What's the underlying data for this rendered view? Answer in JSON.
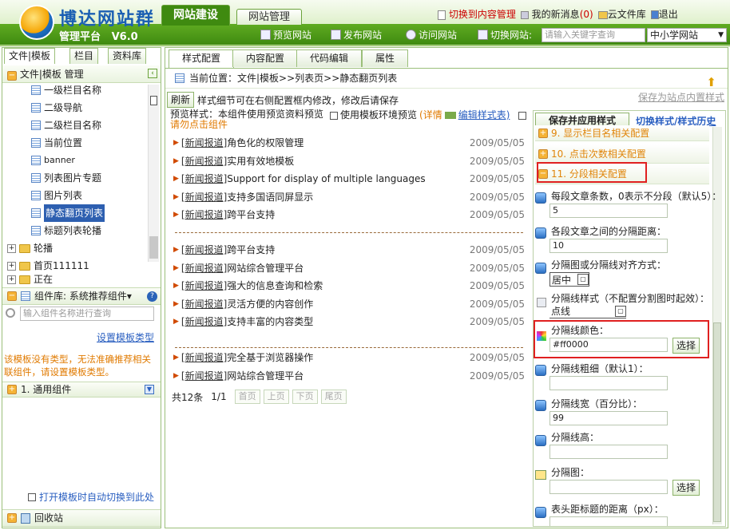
{
  "app": {
    "brand": "博达网站群",
    "subtitle": "管理平台",
    "version": "V6.0",
    "top_tabs": [
      "网站建设",
      "网站管理"
    ],
    "top_links": {
      "switch_content": "切换到内容管理",
      "messages": "我的新消息",
      "message_count": "(0)",
      "cloud_files": "云文件库",
      "logout": "退出"
    },
    "toolbar": {
      "preview_site": "预览网站",
      "publish_site": "发布网站",
      "visit_site": "访问网站",
      "switch_site": "切换网站:",
      "search_placeholder": "请输入关键字查询",
      "site_select": "中小学网站"
    }
  },
  "left": {
    "tabs": [
      "文件|模板",
      "栏目",
      "资料库"
    ],
    "tree_title": "文件|模板 管理",
    "tree_items": [
      "一级栏目名称",
      "二级导航",
      "二级栏目名称",
      "当前位置",
      "banner",
      "列表图片专题",
      "图片列表",
      "静态翻页列表",
      "标题列表轮播"
    ],
    "folders": [
      "轮播",
      "首页111111",
      "正在"
    ],
    "component_lib": "组件库: 系统推荐组件",
    "component_search_placeholder": "输入组件名称进行查询",
    "set_template_type": "设置模板类型",
    "warning": "该模板没有类型，无法准确推荐相关联组件，请设置模板类型。",
    "group_item": "1.  通用组件",
    "auto_switch": "打开模板时自动切换到此处",
    "recycle": "回收站"
  },
  "main": {
    "tabs": [
      "样式配置",
      "内容配置",
      "代码编辑",
      "属性"
    ],
    "breadcrumb": "当前位置：文件|模板>>列表页>>静态翻页列表",
    "refresh": "刷新",
    "hint": "样式细节可在右侧配置框内修改，修改后请保存",
    "save_as_internal": "保存为站点内置样式",
    "preview_label": "预览样式：本组件使用预览资料预览",
    "preview_click": "请勿点击组件",
    "use_template_env": "使用模板环境预览",
    "detail": "(详情",
    "edit_style_table": "编辑样式表)",
    "news_group1": [
      {
        "cat": "[新闻报道]",
        "title": "角色化的权限管理",
        "date": "2009/05/05"
      },
      {
        "cat": "[新闻报道]",
        "title": "实用有效地模板",
        "date": "2009/05/05"
      },
      {
        "cat": "[新闻报道]",
        "title": "Support for display of multiple languages",
        "date": "2009/05/05"
      },
      {
        "cat": "[新闻报道]",
        "title": "支持多国语同屏显示",
        "date": "2009/05/05"
      },
      {
        "cat": "[新闻报道]",
        "title": "跨平台支持",
        "date": "2009/05/05"
      }
    ],
    "news_group2": [
      {
        "cat": "[新闻报道]",
        "title": "跨平台支持",
        "date": "2009/05/05"
      },
      {
        "cat": "[新闻报道]",
        "title": "网站综合管理平台",
        "date": "2009/05/05"
      },
      {
        "cat": "[新闻报道]",
        "title": "强大的信息查询和检索",
        "date": "2009/05/05"
      },
      {
        "cat": "[新闻报道]",
        "title": "灵活方便的内容创作",
        "date": "2009/05/05"
      },
      {
        "cat": "[新闻报道]",
        "title": "支持丰富的内容类型",
        "date": "2009/05/05"
      }
    ],
    "news_group3": [
      {
        "cat": "[新闻报道]",
        "title": "完全基于浏览器操作",
        "date": "2009/05/05"
      },
      {
        "cat": "[新闻报道]",
        "title": "网站综合管理平台",
        "date": "2009/05/05"
      }
    ],
    "pager": {
      "total": "共12条",
      "page": "1/1",
      "first": "首页",
      "prev": "上页",
      "next": "下页",
      "last": "尾页"
    }
  },
  "config": {
    "save_apply": "保存并应用样式",
    "switch_history": "切换样式/样式历史",
    "sections": [
      "9. 显示栏目名相关配置",
      "10. 点击次数相关配置",
      "11. 分段相关配置"
    ],
    "fields": {
      "per_segment_label": "每段文章条数，0表示不分段（默认5）：",
      "per_segment_value": "5",
      "segment_distance_label": "各段文章之间的分隔距离：",
      "segment_distance_value": "10",
      "align_label": "分隔图或分隔线对齐方式：",
      "align_value": "居中",
      "line_style_label": "分隔线样式（不配置分割图时起效）：",
      "line_style_value": "点线",
      "line_color_label": "分隔线颜色：",
      "line_color_value": "#ff0000",
      "choose": "选择",
      "line_thickness_label": "分隔线粗细（默认1）：",
      "line_width_label": "分隔线宽（百分比）：",
      "line_width_value": "99",
      "line_height_label": "分隔线高：",
      "sep_image_label": "分隔图：",
      "header_distance_label": "表头距标题的距离（px）："
    }
  }
}
